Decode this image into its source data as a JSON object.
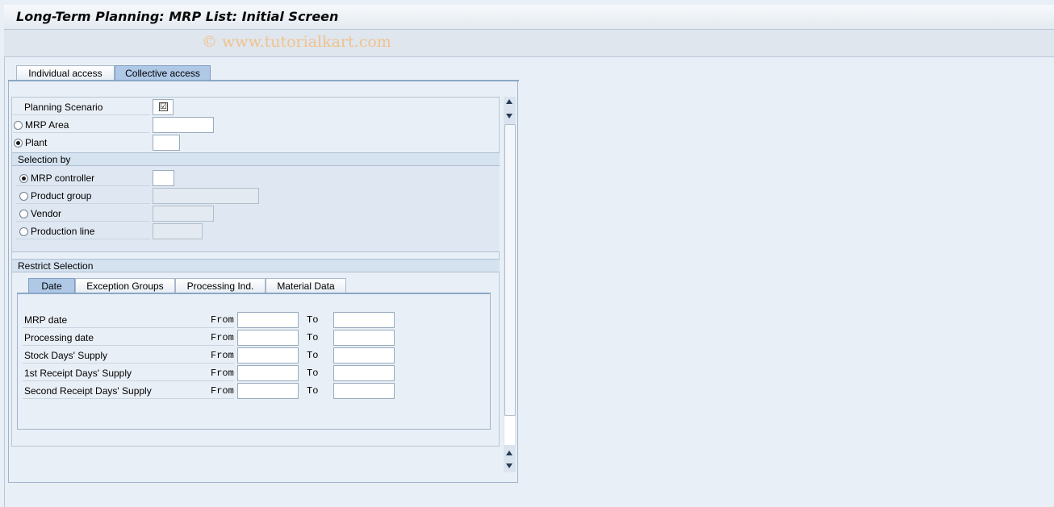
{
  "window": {
    "title": "Long-Term Planning: MRP List: Initial Screen",
    "watermark": "© www.tutorialkart.com"
  },
  "main_tabs": [
    {
      "label": "Individual access",
      "active": false
    },
    {
      "label": "Collective access",
      "active": true
    }
  ],
  "form": {
    "planning_scenario": {
      "label": "Planning Scenario",
      "checked": true,
      "check_glyph": "☑"
    },
    "mrp_area": {
      "label": "MRP Area",
      "selected": false,
      "value": ""
    },
    "plant": {
      "label": "Plant",
      "selected": true,
      "value": ""
    }
  },
  "selection_by": {
    "header": "Selection by",
    "options": [
      {
        "label": "MRP controller",
        "selected": true,
        "value": "",
        "enabled": true
      },
      {
        "label": "Product group",
        "selected": false,
        "value": "",
        "enabled": false
      },
      {
        "label": "Vendor",
        "selected": false,
        "value": "",
        "enabled": false
      },
      {
        "label": "Production line",
        "selected": false,
        "value": "",
        "enabled": false
      }
    ]
  },
  "restrict_selection": {
    "header": "Restrict Selection",
    "tabs": [
      {
        "label": "Date",
        "active": true
      },
      {
        "label": "Exception Groups",
        "active": false
      },
      {
        "label": "Processing Ind.",
        "active": false
      },
      {
        "label": "Material Data",
        "active": false
      }
    ],
    "from_label": "From",
    "to_label": "To",
    "rows": [
      {
        "label": "MRP date",
        "from": "",
        "to": ""
      },
      {
        "label": "Processing date",
        "from": "",
        "to": ""
      },
      {
        "label": "Stock Days' Supply",
        "from": "",
        "to": ""
      },
      {
        "label": "1st Receipt Days' Supply",
        "from": "",
        "to": ""
      },
      {
        "label": "Second Receipt Days' Supply",
        "from": "",
        "to": ""
      }
    ]
  }
}
